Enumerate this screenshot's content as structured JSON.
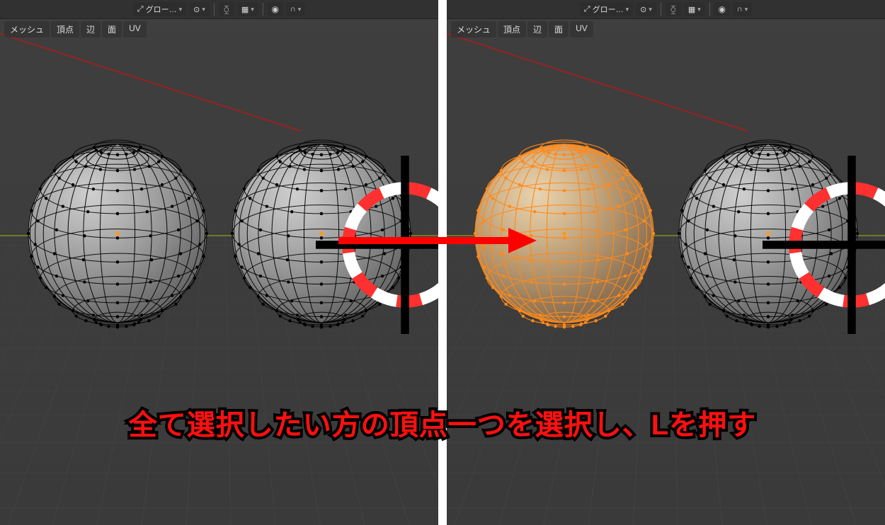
{
  "header": {
    "orientation_label": "グロー…",
    "snap_icon": "magnet",
    "prop_edit_icon": "proportional",
    "pivot_icon": "pivot"
  },
  "menu": {
    "items": [
      "メッシュ",
      "頂点",
      "辺",
      "面",
      "UV"
    ]
  },
  "annotation": {
    "caption": "全て選択したい方の頂点一つを選択し、Lを押す"
  },
  "colors": {
    "accent_select": "#ff8a1a",
    "arrow": "#ff0000",
    "axis_x": "#b02020",
    "axis_y": "#8aa820"
  },
  "state": {
    "left_panel": {
      "sphere_a_selected": false,
      "sphere_b_selected": false
    },
    "right_panel": {
      "sphere_a_selected": true,
      "sphere_b_selected": false
    }
  }
}
